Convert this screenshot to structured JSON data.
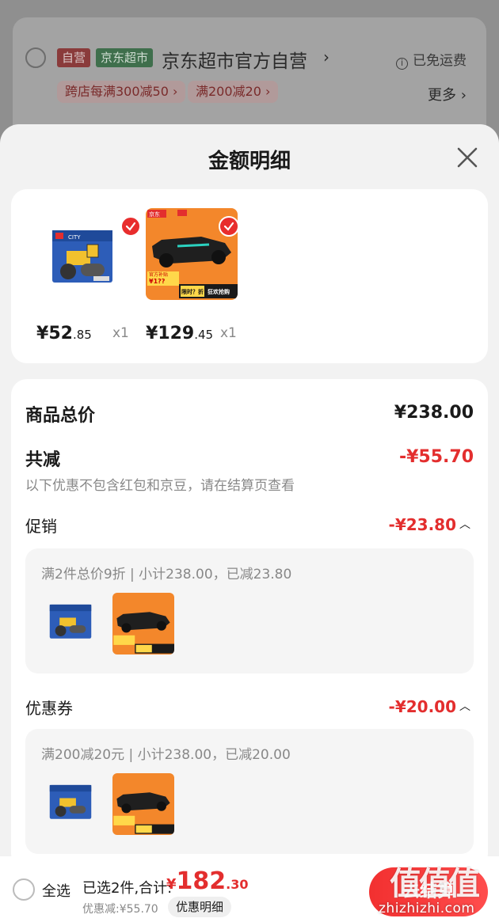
{
  "background": {
    "tag_self": "自营",
    "tag_market": "京东超市",
    "shop_name": "京东超市官方自营",
    "shipping": "已免运费",
    "promos": [
      "跨店每满300减50 ›",
      "满200减20 ›"
    ],
    "more": "更多 ›"
  },
  "sheet": {
    "title": "金额明细"
  },
  "products": [
    {
      "price_symbol": "¥",
      "price_main": "52",
      "price_cents": ".85",
      "qty": "x1"
    },
    {
      "price_symbol": "¥",
      "price_main": "129",
      "price_cents": ".45",
      "qty": "x1"
    }
  ],
  "summary": {
    "total_label": "商品总价",
    "total_value": "¥238.00",
    "discount_label": "共减",
    "discount_value": "-¥55.70",
    "note": "以下优惠不包含红包和京豆，请在结算页查看"
  },
  "promotion": {
    "label": "促销",
    "value": "-¥23.80",
    "detail": "满2件总价9折 | 小计238.00，已减23.80"
  },
  "coupon": {
    "label": "优惠券",
    "value": "-¥20.00",
    "detail": "满200减20元 | 小计238.00，已减20.00"
  },
  "bottom": {
    "select_all": "全选",
    "selected": "已选2件,合计:",
    "total_symbol": "¥",
    "total_main": "182",
    "total_dec": ".30",
    "discount": "优惠减:¥55.70",
    "detail_pill": "优惠明细",
    "checkout": "去结算"
  },
  "thumb_text": {
    "jd_badge": "京东",
    "lego_badge": "LEGO",
    "limited": "限时？折",
    "grab": "狂欢抢购",
    "mark": "官方补贴",
    "price_q": "¥1??"
  },
  "watermark": {
    "logo": "值值值",
    "site": "zhizhizhi.com"
  },
  "colors": {
    "accent_red": "#e32e2e",
    "check_red": "#e82d2d"
  }
}
